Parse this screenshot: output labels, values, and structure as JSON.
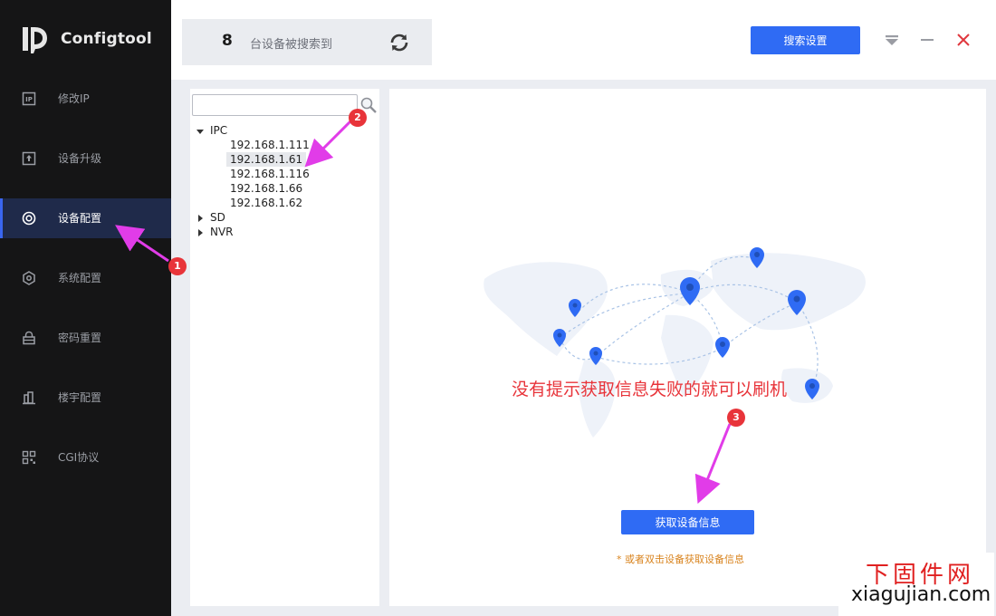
{
  "app": {
    "name": "Configtool"
  },
  "sidebar": {
    "items": [
      {
        "key": "ip",
        "label": "修改IP",
        "icon": "ip-icon",
        "active": false
      },
      {
        "key": "upgrade",
        "label": "设备升级",
        "icon": "upload-icon",
        "active": false
      },
      {
        "key": "config",
        "label": "设备配置",
        "icon": "target-icon",
        "active": true
      },
      {
        "key": "system",
        "label": "系统配置",
        "icon": "hexagon-gear-icon",
        "active": false
      },
      {
        "key": "password",
        "label": "密码重置",
        "icon": "lock-icon",
        "active": false
      },
      {
        "key": "building",
        "label": "楼宇配置",
        "icon": "building-icon",
        "active": false
      },
      {
        "key": "cgi",
        "label": "CGI协议",
        "icon": "qr-code-icon",
        "active": false
      }
    ]
  },
  "header": {
    "device_count": "8",
    "device_count_label": "台设备被搜索到",
    "search_settings_label": "搜索设置"
  },
  "tree": {
    "search_value": "",
    "groups": [
      {
        "label": "IPC",
        "expanded": true
      },
      {
        "label": "SD",
        "expanded": false
      },
      {
        "label": "NVR",
        "expanded": false
      }
    ],
    "ipc_devices": [
      "192.168.1.111",
      "192.168.1.61",
      "192.168.1.116",
      "192.168.1.66",
      "192.168.1.62"
    ],
    "selected_device": "192.168.1.61"
  },
  "content": {
    "get_info_label": "获取设备信息",
    "hint": "* 或者双击设备获取设备信息"
  },
  "annotations": {
    "note": "没有提示获取信息失败的就可以刷机",
    "badges": [
      "1",
      "2",
      "3"
    ],
    "arrow_color": "#e13ce8",
    "badge_color": "#e8343a"
  },
  "watermark": {
    "cn": "下固件网",
    "en": "xiagujian.com"
  },
  "colors": {
    "accent": "#2f6bf4",
    "sidebar_bg": "#151516",
    "sidebar_active_bg": "#1f2a4a",
    "hint": "#d9841f",
    "close": "#e0383e"
  }
}
